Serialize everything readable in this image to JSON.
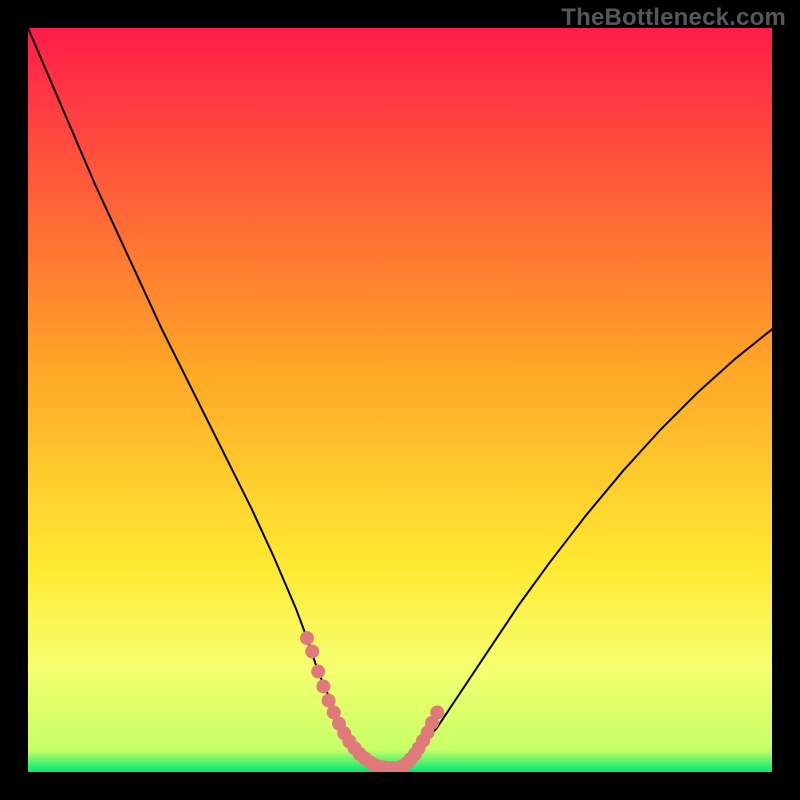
{
  "watermark": "TheBottleneck.com",
  "colors": {
    "gradient_top": "#ff1c4a",
    "gradient_mid": "#ffa427",
    "gradient_low": "#ffe932",
    "gradient_band": "#f5ff6f",
    "gradient_bottom": "#00e874",
    "curve": "#000000",
    "marker": "#e07a7a",
    "frame": "#000000"
  },
  "chart_data": {
    "type": "line",
    "title": "",
    "xlabel": "",
    "ylabel": "",
    "xlim": [
      0,
      100
    ],
    "ylim": [
      0,
      100
    ],
    "grid": false,
    "legend": false,
    "series": [
      {
        "name": "bottleneck-curve",
        "x": [
          0,
          3,
          6,
          9,
          12,
          15,
          18,
          21,
          24,
          27,
          30,
          33,
          36,
          37.5,
          39,
          40.7,
          42.4,
          44,
          45.5,
          47,
          48.3,
          49.7,
          52,
          55,
          58,
          62,
          66,
          70,
          75,
          80,
          85,
          90,
          95,
          100
        ],
        "y": [
          100,
          93,
          86,
          79,
          72.5,
          66,
          59.5,
          53.5,
          47.5,
          41.5,
          35.5,
          29,
          22,
          18,
          13.5,
          9.5,
          6.0,
          3.2,
          1.6,
          0.8,
          0.4,
          0.6,
          2.4,
          6.0,
          10.5,
          16.5,
          22.5,
          28.0,
          34.5,
          40.5,
          46.0,
          51.0,
          55.5,
          59.5
        ]
      }
    ],
    "markers": {
      "name": "bottom-band",
      "x": [
        37.5,
        38.2,
        39,
        39.7,
        40.4,
        41.1,
        41.8,
        42.5,
        43.2,
        43.9,
        44.6,
        45.3,
        46,
        46.7,
        47.3,
        47.9,
        48.4,
        48.9,
        49.4,
        49.9,
        50.4,
        50.9,
        51.4,
        52.0,
        52.5,
        53.1,
        53.7,
        54.3,
        55.0
      ],
      "y": [
        18.0,
        16.2,
        13.5,
        11.5,
        9.6,
        8.0,
        6.5,
        5.2,
        4.1,
        3.2,
        2.4,
        1.8,
        1.3,
        0.9,
        0.7,
        0.6,
        0.5,
        0.5,
        0.5,
        0.6,
        0.8,
        1.2,
        1.7,
        2.4,
        3.2,
        4.2,
        5.3,
        6.6,
        8.0
      ]
    },
    "annotations": []
  }
}
